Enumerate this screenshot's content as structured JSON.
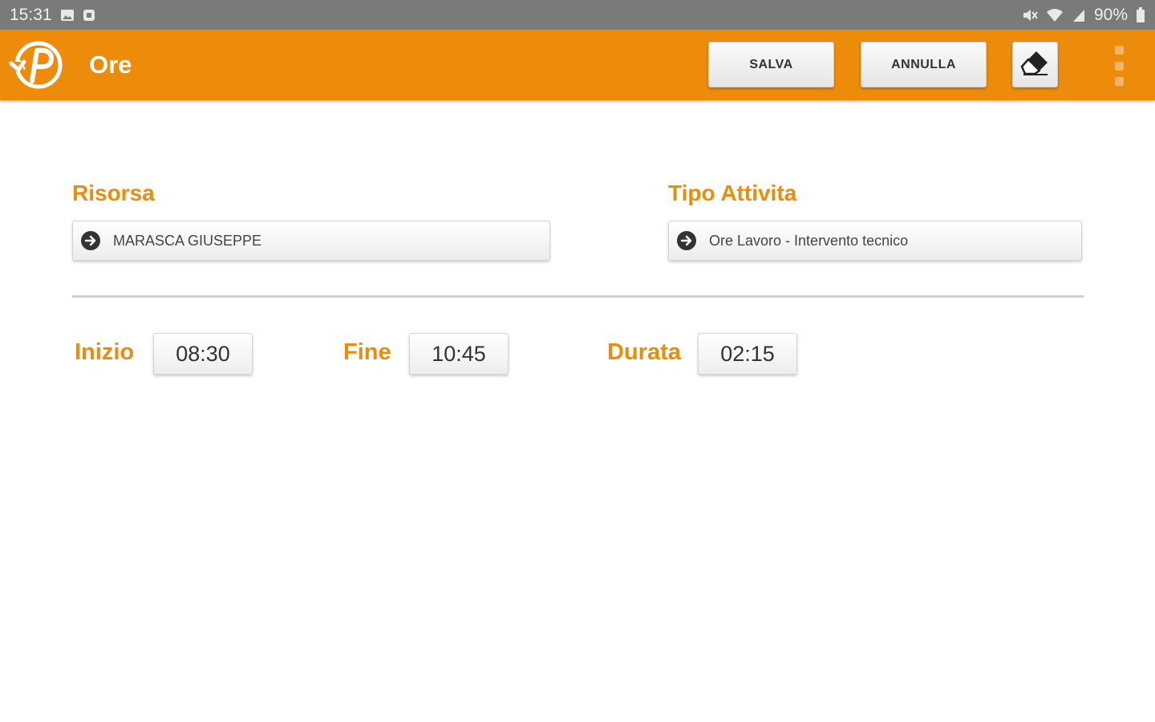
{
  "status_bar": {
    "time": "15:31",
    "battery": "90%",
    "icons": [
      "image-icon",
      "app-notification-icon",
      "mute-icon",
      "wifi-icon",
      "signal-icon",
      "battery-icon"
    ]
  },
  "app_bar": {
    "title": "Ore",
    "save_label": "SALVA",
    "cancel_label": "ANNULLA",
    "icons": [
      "app-logo",
      "eraser-icon",
      "overflow-menu-icon"
    ],
    "colors": {
      "accent": "#ec8c0a"
    }
  },
  "form": {
    "resource": {
      "label": "Risorsa",
      "value": "MARASCA GIUSEPPE"
    },
    "activity_type": {
      "label": "Tipo Attivita",
      "value": "Ore Lavoro - Intervento tecnico"
    },
    "start": {
      "label": "Inizio",
      "value": "08:30"
    },
    "end": {
      "label": "Fine",
      "value": "10:45"
    },
    "duration": {
      "label": "Durata",
      "value": "02:15"
    }
  }
}
